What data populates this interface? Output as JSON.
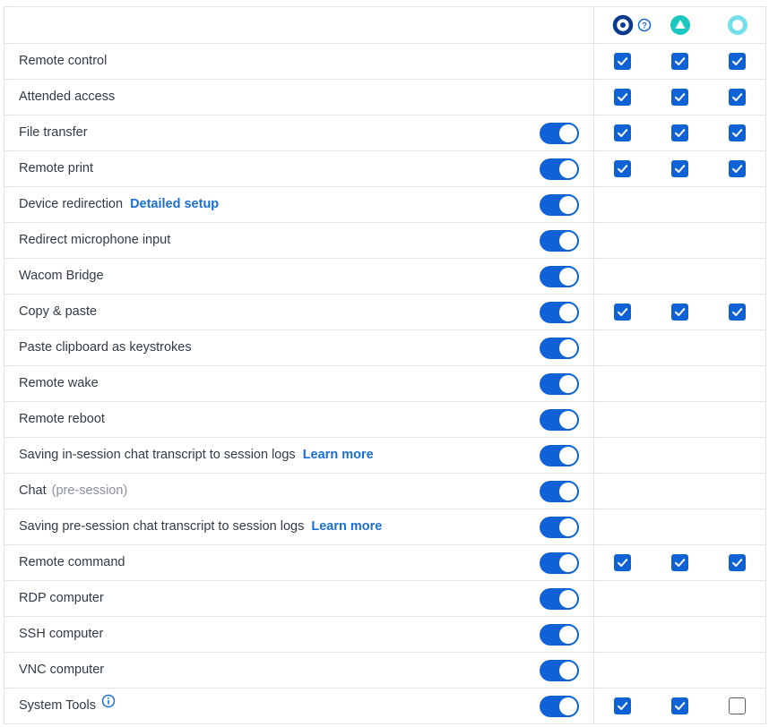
{
  "colors": {
    "accent": "#0e62d6",
    "link": "#1a6fd6",
    "border": "#e1e4e8",
    "teal": "#1cc7c0",
    "light_teal": "#74dfea",
    "navy": "#0a3a8c"
  },
  "header": {
    "columns": [
      {
        "icon": "navy-ring-icon",
        "help_icon": "question-circle-icon"
      },
      {
        "icon": "teal-triangle-icon"
      },
      {
        "icon": "light-teal-ring-icon"
      }
    ]
  },
  "rows": [
    {
      "label": "Remote control",
      "toggle": null,
      "checks": [
        true,
        true,
        true
      ]
    },
    {
      "label": "Attended access",
      "toggle": null,
      "checks": [
        true,
        true,
        true
      ]
    },
    {
      "label": "File transfer",
      "toggle": true,
      "checks": [
        true,
        true,
        true
      ]
    },
    {
      "label": "Remote print",
      "toggle": true,
      "checks": [
        true,
        true,
        true
      ]
    },
    {
      "label": "Device redirection",
      "link": "Detailed setup",
      "toggle": true,
      "checks": null
    },
    {
      "label": "Redirect microphone input",
      "toggle": true,
      "checks": null
    },
    {
      "label": "Wacom Bridge",
      "toggle": true,
      "checks": null
    },
    {
      "label": "Copy & paste",
      "toggle": true,
      "checks": [
        true,
        true,
        true
      ]
    },
    {
      "label": "Paste clipboard as keystrokes",
      "toggle": true,
      "checks": null
    },
    {
      "label": "Remote wake",
      "toggle": true,
      "checks": null
    },
    {
      "label": "Remote reboot",
      "toggle": true,
      "checks": null
    },
    {
      "label": "Saving in-session chat transcript to session logs",
      "link": "Learn more",
      "toggle": true,
      "checks": null
    },
    {
      "label": "Chat",
      "muted": "(pre-session)",
      "toggle": true,
      "checks": null
    },
    {
      "label": "Saving pre-session chat transcript to session logs",
      "link": "Learn more",
      "toggle": true,
      "checks": null
    },
    {
      "label": "Remote command",
      "toggle": true,
      "checks": [
        true,
        true,
        true
      ]
    },
    {
      "label": "RDP computer",
      "toggle": true,
      "checks": null
    },
    {
      "label": "SSH computer",
      "toggle": true,
      "checks": null
    },
    {
      "label": "VNC computer",
      "toggle": true,
      "checks": null
    },
    {
      "label": "System Tools",
      "info_icon": "info-circle-icon",
      "toggle": true,
      "checks": [
        true,
        true,
        false
      ]
    }
  ]
}
